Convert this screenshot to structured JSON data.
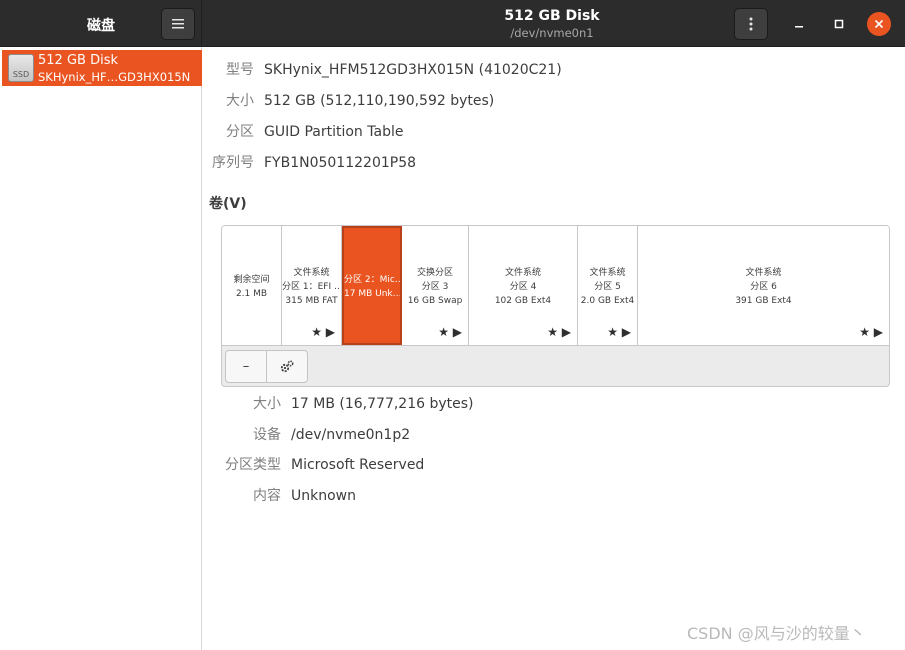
{
  "app": {
    "sidebar_title": "磁盘",
    "sidebar_menu_icon": "hamburger-menu-icon",
    "window_title": "512 GB Disk",
    "window_subtitle": "/dev/nvme0n1",
    "kebab_icon": "vertical-dots-icon"
  },
  "window_controls": {
    "minimize": "–",
    "maximize": "□",
    "close": "✕"
  },
  "sidebar": {
    "items": [
      {
        "icon_text": "SSD",
        "name": "512 GB Disk",
        "model": "SKHynix_HF…GD3HX015N",
        "selected": true
      }
    ]
  },
  "disk_info": [
    {
      "label": "型号",
      "value": "SKHynix_HFM512GD3HX015N (41020C21)"
    },
    {
      "label": "大小",
      "value": "512 GB (512,110,190,592 bytes)"
    },
    {
      "label": "分区",
      "value": "GUID Partition Table"
    },
    {
      "label": "序列号",
      "value": "FYB1N050112201P58"
    }
  ],
  "volumes": {
    "section_title": "卷(V)",
    "segments": [
      {
        "lines": [
          "剩余空间",
          "2.1 MB"
        ],
        "icons": "",
        "selected": false
      },
      {
        "lines": [
          "文件系统",
          "分区 1：EFI …",
          "315 MB FAT"
        ],
        "icons": "★ ▶",
        "selected": false
      },
      {
        "lines": [
          "分区 2：Mic…",
          "17 MB Unk…"
        ],
        "icons": "",
        "selected": true
      },
      {
        "lines": [
          "交换分区",
          "分区 3",
          "16 GB Swap"
        ],
        "icons": "★ ▶",
        "selected": false
      },
      {
        "lines": [
          "文件系统",
          "分区 4",
          "102 GB Ext4"
        ],
        "icons": "★ ▶",
        "selected": false
      },
      {
        "lines": [
          "文件系统",
          "分区 5",
          "2.0 GB Ext4"
        ],
        "icons": "★ ▶",
        "selected": false
      },
      {
        "lines": [
          "文件系统",
          "分区 6",
          "391 GB Ext4"
        ],
        "icons": "★ ▶",
        "selected": false
      }
    ],
    "toolbar": {
      "remove_label": "–",
      "settings_icon": "gears-icon"
    }
  },
  "partition_info": [
    {
      "label": "大小",
      "value": "17 MB (16,777,216 bytes)"
    },
    {
      "label": "设备",
      "value": "/dev/nvme0n1p2"
    },
    {
      "label": "分区类型",
      "value": "Microsoft Reserved"
    },
    {
      "label": "内容",
      "value": "Unknown"
    }
  ],
  "watermark": "CSDN @风与沙的较量丶",
  "colors": {
    "accent": "#e95420",
    "headerbar": "#2c2c2c",
    "label_gray": "#808080"
  }
}
